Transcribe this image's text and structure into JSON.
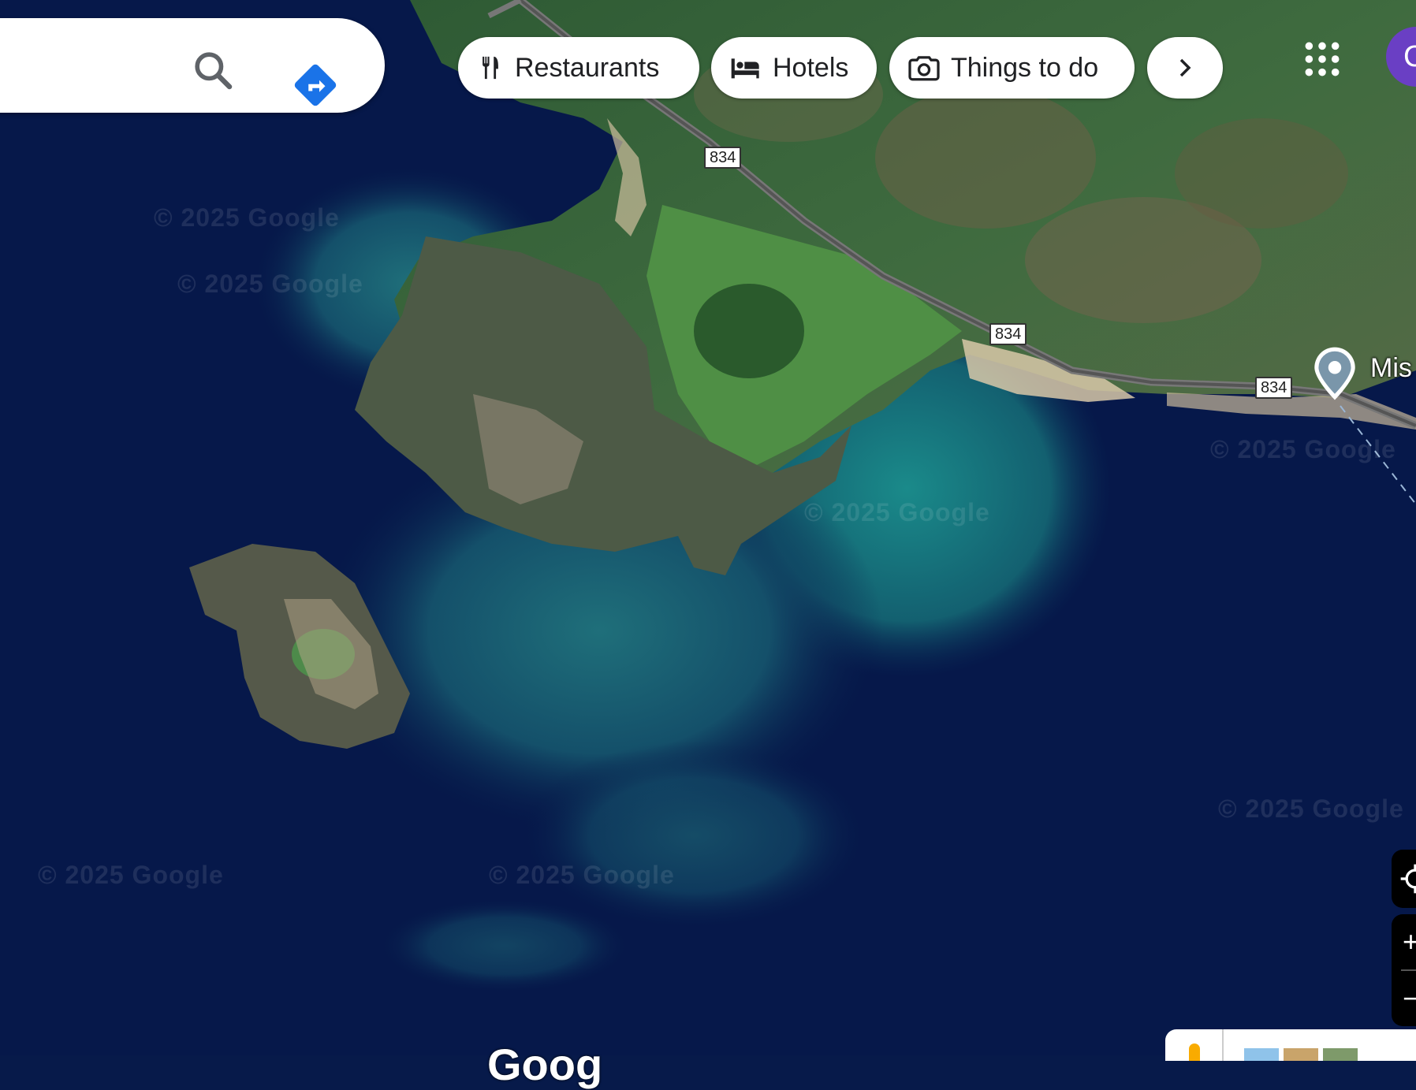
{
  "search": {
    "value": "",
    "placeholder": ""
  },
  "chips": [
    {
      "label": "Restaurants",
      "icon": "restaurant-icon"
    },
    {
      "label": "Hotels",
      "icon": "hotel-icon"
    },
    {
      "label": "Things to do",
      "icon": "camera-icon"
    }
  ],
  "map": {
    "road_number": "834",
    "watermark": "© 2025 Google",
    "place_label": "Mis",
    "google_logo": "Goog"
  },
  "user": {
    "avatar_initial": "C"
  },
  "zoom": {
    "in_label": "+",
    "out_label": "−"
  },
  "colors": {
    "accent_blue": "#1a73e8",
    "ocean_deep": "#071a4a",
    "land_green": "#2f6b3a",
    "avatar": "#6a3fc4"
  }
}
